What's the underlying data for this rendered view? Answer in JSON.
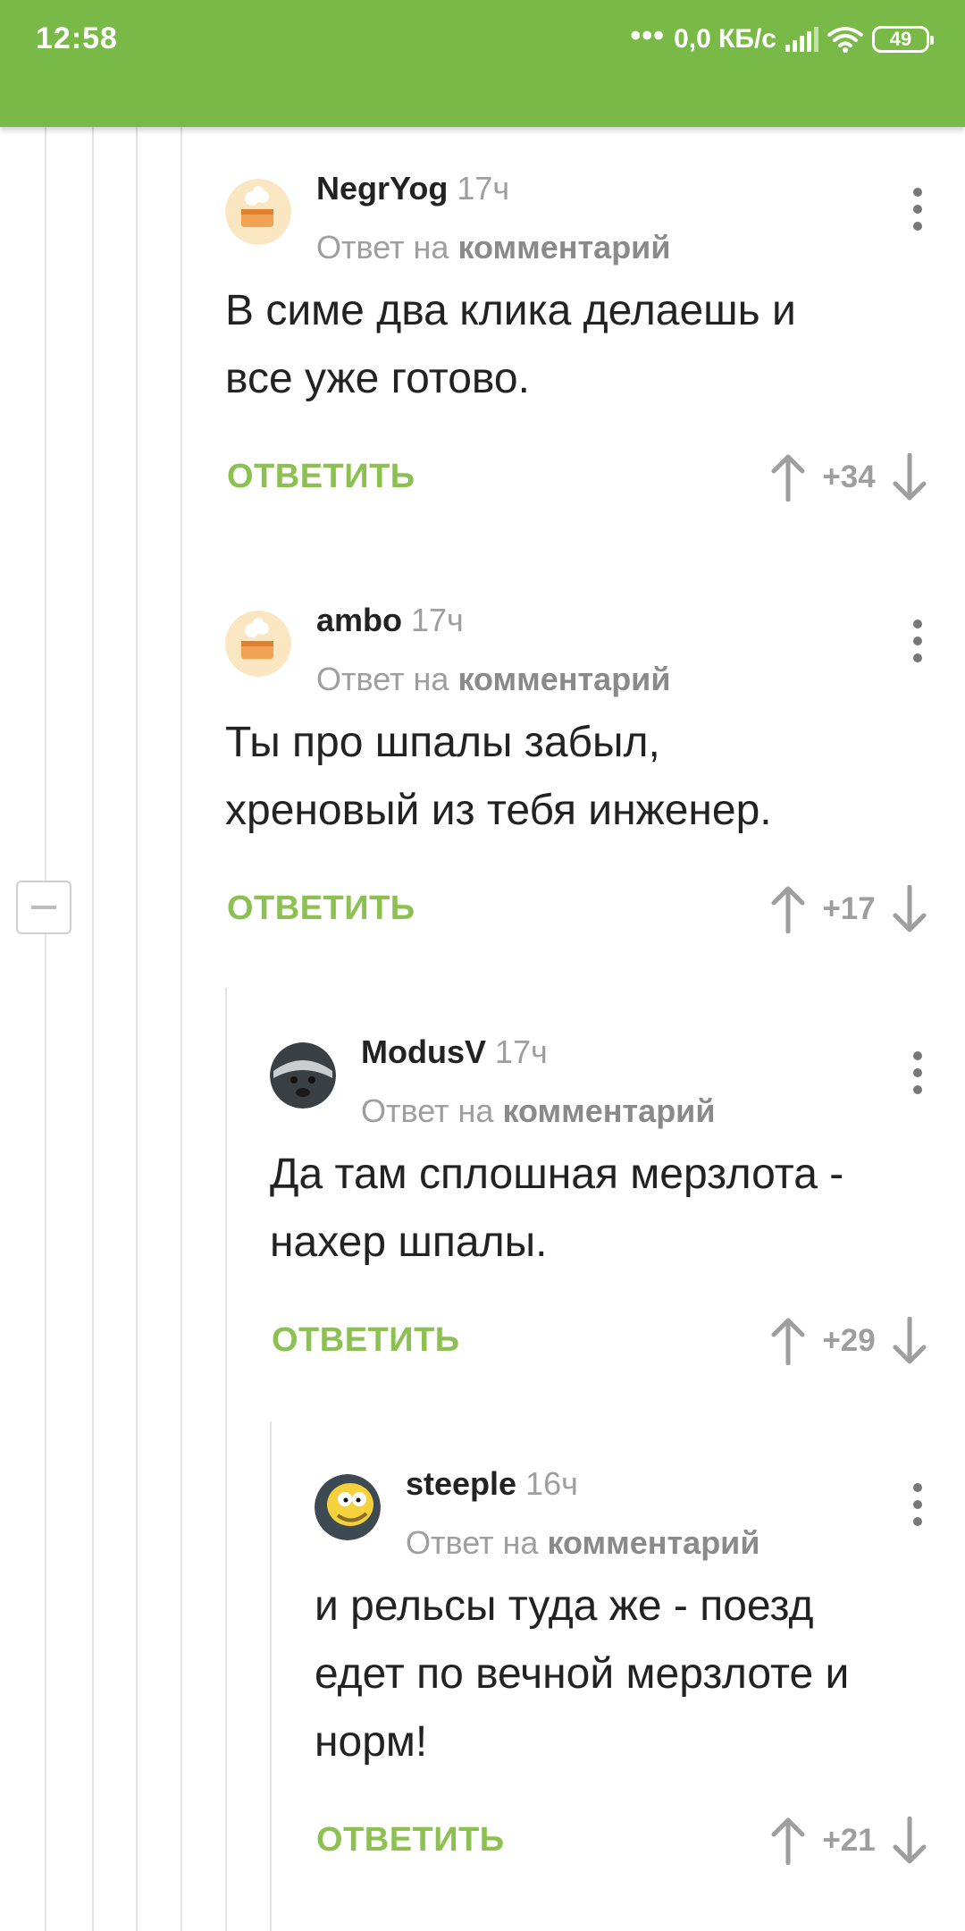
{
  "status_bar": {
    "time": "12:58",
    "dots": "•••",
    "speed": "0,0 КБ/с",
    "battery": "49",
    "icons": [
      "signal-icon",
      "wifi-icon",
      "battery-icon"
    ]
  },
  "theme": {
    "header_color": "#79b947",
    "reply_color": "#8cc152",
    "meta_color": "#9e9e9e"
  },
  "comments": [
    {
      "author": "NegrYog",
      "time": "17ч",
      "reply_prefix": "Ответ на",
      "reply_link": "комментарий",
      "text_line1": "В симе два клика делаешь и",
      "text_line2": "все уже готово.",
      "reply_label": "ОТВЕТИТЬ",
      "score": "+34",
      "avatar": "cake-avatar"
    },
    {
      "author": "ambo",
      "time": "17ч",
      "reply_prefix": "Ответ на",
      "reply_link": "комментарий",
      "text_line1": "Ты про шпалы забыл,",
      "text_line2": "хреновый из тебя инженер.",
      "reply_label": "ОТВЕТИТЬ",
      "score": "+17",
      "avatar": "cake-avatar"
    },
    {
      "author": "ModusV",
      "time": "17ч",
      "reply_prefix": "Ответ на",
      "reply_link": "комментарий",
      "text_line1": "Да там сплошная мерзлота -",
      "text_line2": "нахер шпалы.",
      "reply_label": "ОТВЕТИТЬ",
      "score": "+29",
      "avatar": "honey-badger-avatar"
    },
    {
      "author": "steeple",
      "time": "16ч",
      "reply_prefix": "Ответ на",
      "reply_link": "комментарий",
      "text_line1": "и рельсы туда же - поезд",
      "text_line2": "едет по вечной мерзлоте и",
      "text_line3": "норм!",
      "reply_label": "ОТВЕТИТЬ",
      "score": "+21",
      "avatar": "cartoon-avatar"
    }
  ]
}
